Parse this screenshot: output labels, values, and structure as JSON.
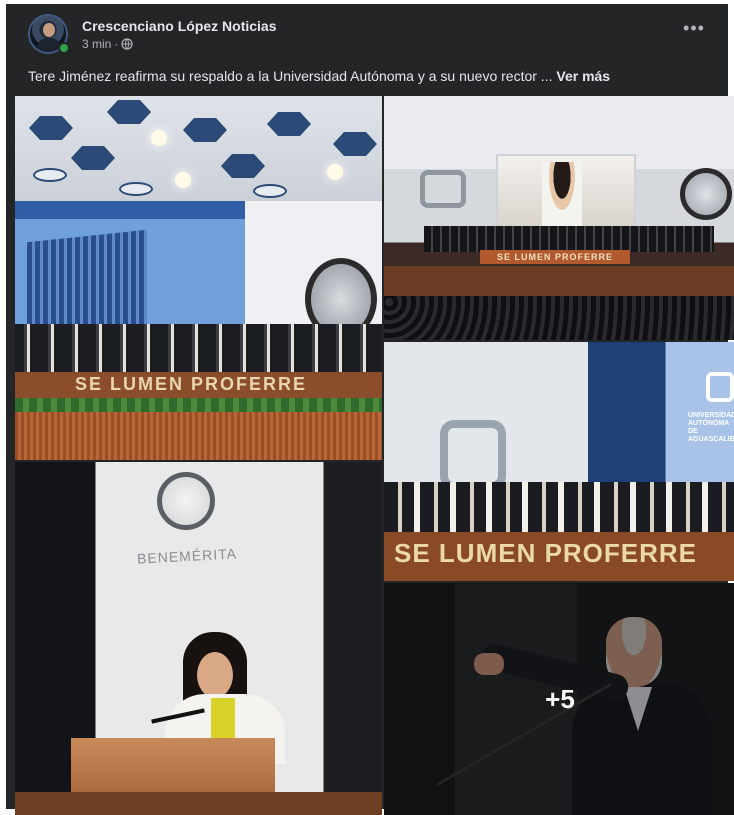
{
  "post": {
    "author": "Crescenciano López Noticias",
    "time": "3 min",
    "separator": "·",
    "privacy_icon": "globe-icon",
    "more_icon": "more-options-icon",
    "more_glyph": "•••",
    "text": "Tere Jiménez reafirma su respaldo a la Universidad Autónoma y a su nuevo rector ...",
    "see_more": "Ver más"
  },
  "photos": {
    "p1_stage_text": "SE LUMEN PROFERRE",
    "p2_banner_text": "SE LUMEN PROFERRE",
    "p3_podium_text": "SE LUMEN PROFERRE",
    "p3_uni_text": "UNIVERSIDAD AUTÓNOMA DE AGUASCALIENTES",
    "p4_logo_text": "BENEMÉRITA",
    "more_count": "+5"
  },
  "colors": {
    "card_bg": "#242526",
    "primary_text": "#e4e6eb",
    "secondary_text": "#b0b3b8",
    "online": "#31a24c"
  }
}
